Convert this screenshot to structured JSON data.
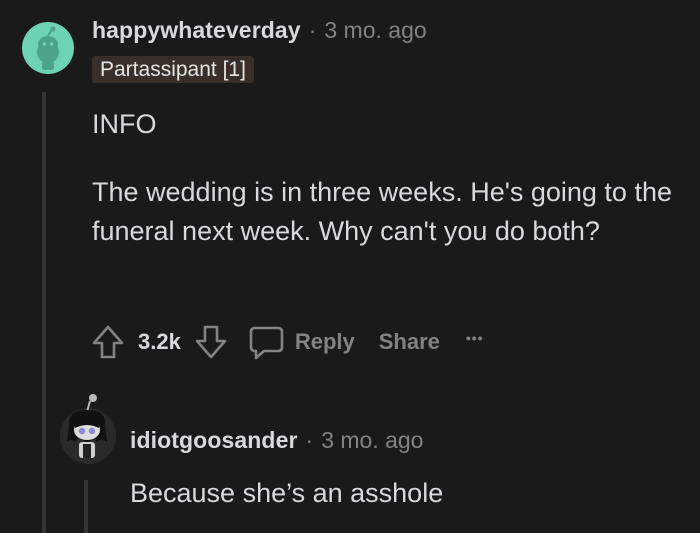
{
  "comment1": {
    "username": "happywhateverday",
    "separator": "·",
    "time": "3 mo. ago",
    "flair": "Partassipant [1]",
    "paragraphs": [
      "INFO",
      "The wedding is in three weeks. He's going to the funeral next week. Why can't you do both?"
    ],
    "votes": "3.2k",
    "reply_label": "Reply",
    "share_label": "Share",
    "more_label": "•••"
  },
  "comment2": {
    "username": "idiotgoosander",
    "separator": "·",
    "time": "3 mo. ago",
    "body": "Because she’s an asshole"
  },
  "colors": {
    "background": "#1a1a1b",
    "avatar_bg": "#6ed3b4",
    "thread_line": "#343536",
    "flair_bg": "#3a2f28"
  }
}
